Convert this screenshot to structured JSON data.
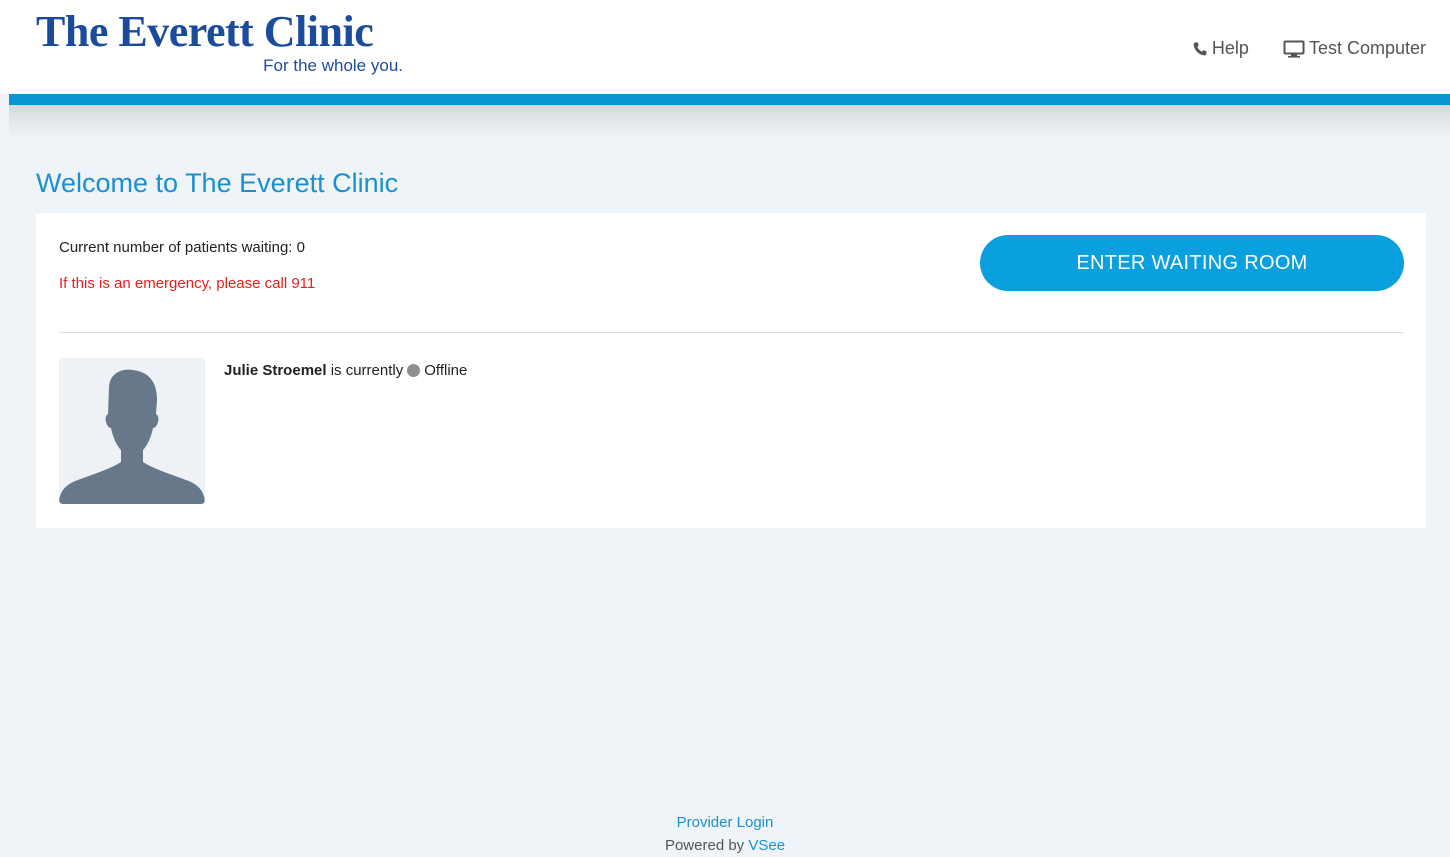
{
  "header": {
    "logo_title": "The Everett Clinic",
    "logo_tagline": "For the whole you.",
    "nav": {
      "help_label": "Help",
      "test_computer_label": "Test Computer"
    }
  },
  "main": {
    "welcome_title": "Welcome to The Everett Clinic",
    "waiting_count_text": "Current number of patients waiting: 0",
    "emergency_text": "If this is an emergency, please call 911",
    "enter_button_label": "ENTER WAITING ROOM",
    "provider": {
      "name": "Julie Stroemel",
      "status_prefix": "is currently",
      "status": "Offline",
      "status_color": "#8e8e8e"
    }
  },
  "footer": {
    "provider_login_label": "Provider Login",
    "powered_by_prefix": "Powered by",
    "powered_by_brand": "VSee"
  },
  "colors": {
    "accent": "#0a96d4",
    "button": "#0aa0df",
    "brand_logo": "#1b4b9b",
    "emergency": "#ee1c1c",
    "page_background": "#eef4f8"
  },
  "icons": {
    "help": "phone-icon",
    "test_computer": "monitor-icon",
    "avatar": "person-silhouette-icon"
  }
}
